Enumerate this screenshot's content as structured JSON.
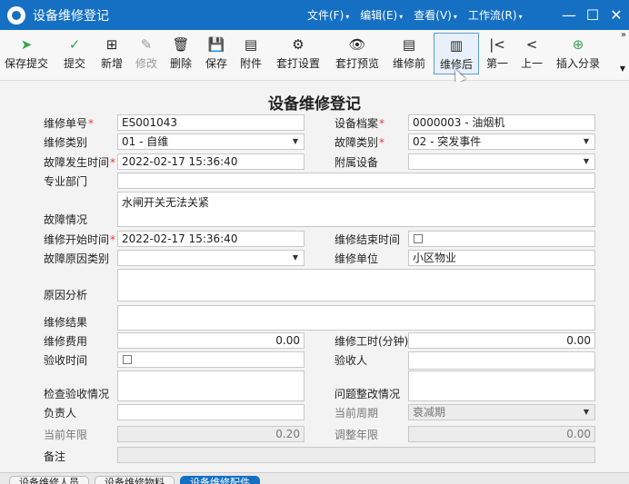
{
  "window": {
    "title": "设备维修登记",
    "menus": [
      {
        "label": "文件(F)"
      },
      {
        "label": "编辑(E)"
      },
      {
        "label": "查看(V)"
      },
      {
        "label": "工作流(R)"
      }
    ],
    "controls": {
      "minimize": "—",
      "maximize": "☐",
      "close": "✕"
    }
  },
  "toolbar": {
    "buttons": [
      {
        "label": "保存提交",
        "icon": "send-icon",
        "glyph": "➤"
      },
      {
        "label": "提交",
        "icon": "check-circle-icon",
        "glyph": "✓"
      },
      {
        "label": "新增",
        "icon": "add-document-icon",
        "glyph": "⊞"
      },
      {
        "label": "修改",
        "icon": "edit-icon",
        "glyph": "✎"
      },
      {
        "label": "删除",
        "icon": "trash-icon",
        "glyph": "🗑"
      },
      {
        "label": "保存",
        "icon": "save-icon",
        "glyph": "💾"
      },
      {
        "label": "附件",
        "icon": "attachment-icon",
        "glyph": "▤"
      },
      {
        "label": "套打设置",
        "icon": "print-settings-icon",
        "glyph": "⚙"
      },
      {
        "label": "套打预览",
        "icon": "eye-icon",
        "glyph": "👁"
      },
      {
        "label": "维修前",
        "icon": "doc-before-icon",
        "glyph": "▤"
      },
      {
        "label": "维修后",
        "icon": "doc-after-icon",
        "glyph": "▥"
      },
      {
        "label": "第一",
        "icon": "first-icon",
        "glyph": "|<"
      },
      {
        "label": "上一",
        "icon": "previous-icon",
        "glyph": "<"
      },
      {
        "label": "插入分录",
        "icon": "insert-plus-icon",
        "glyph": "⊕"
      }
    ],
    "more": "»"
  },
  "form": {
    "title": "设备维修登记",
    "labels": {
      "repair_no": "维修单号",
      "equipment_file": "设备档案",
      "repair_type": "维修类别",
      "fault_type": "故障类别",
      "fault_time": "故障发生时间",
      "attached_equipment": "附属设备",
      "department": "专业部门",
      "fault_desc": "故障情况",
      "repair_start": "维修开始时间",
      "repair_end": "维修结束时间",
      "cause_type": "故障原因类别",
      "repair_unit": "维修单位",
      "cause_analysis": "原因分析",
      "repair_result": "维修结果",
      "repair_cost": "维修费用",
      "repair_hours": "维修工时(分钟)",
      "accept_time": "验收时间",
      "acceptor": "验收人",
      "inspection": "检查验收情况",
      "rectification": "问题整改情况",
      "person_in_charge": "负责人",
      "current_period": "当前周期",
      "current_life": "当前年限",
      "adjusted_life": "调整年限",
      "remark": "备注"
    },
    "values": {
      "repair_no": "ES001043",
      "equipment_file": "0000003 - 油烟机",
      "repair_type": "01 - 自维",
      "fault_type": "02 - 突发事件",
      "fault_time": "2022-02-17 15:36:40",
      "attached_equipment": "",
      "department": "",
      "fault_desc": "水闸开关无法关紧",
      "repair_start": "2022-02-17 15:36:40",
      "repair_end": "",
      "cause_type": "",
      "repair_unit": "小区物业",
      "cause_analysis": "",
      "repair_result": "",
      "repair_cost": "0.00",
      "repair_hours": "0.00",
      "acceptor": "",
      "inspection": "",
      "rectification": "",
      "person_in_charge": "",
      "current_period": "衰减期",
      "current_life": "0.20",
      "adjusted_life": "0.00",
      "remark": ""
    },
    "required_mark": "*"
  },
  "tabs": [
    {
      "label": "设备维修人员"
    },
    {
      "label": "设备维修物料"
    },
    {
      "label": "设备维修配件"
    }
  ]
}
